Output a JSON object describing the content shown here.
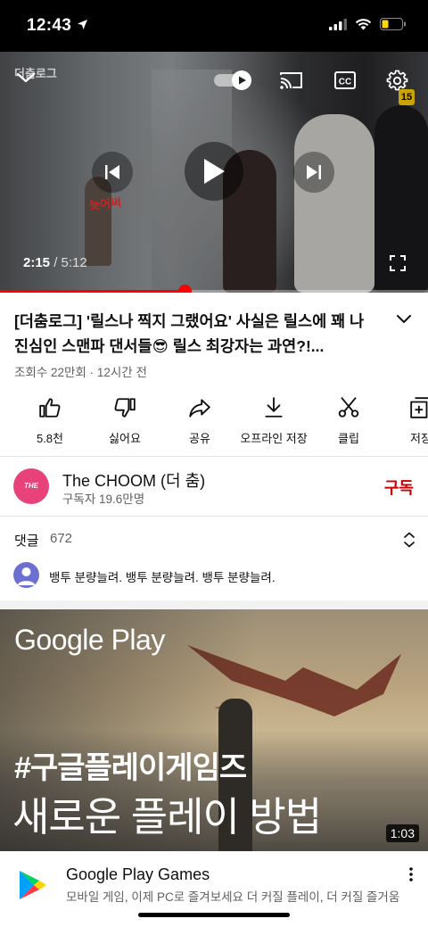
{
  "status_bar": {
    "time": "12:43"
  },
  "player": {
    "current_time": "2:15",
    "duration": "/ 5:12",
    "progress": 0.432,
    "channel_watermark": "더춤로그",
    "subtitle_overlay": "늦어써",
    "age_badge": "15"
  },
  "video": {
    "title": "[더춤로그] '릴스나 찍지 그랬어요' 사실은 릴스에 꽤 나 진심인 스맨파 댄서들😎 릴스 최강자는 과연?!...",
    "meta": "조회수 22만회 · 12시간 전"
  },
  "actions": [
    {
      "label": "5.8천",
      "icon": "thumb-up-icon"
    },
    {
      "label": "싫어요",
      "icon": "thumb-down-icon"
    },
    {
      "label": "공유",
      "icon": "share-icon"
    },
    {
      "label": "오프라인 저장",
      "icon": "download-icon"
    },
    {
      "label": "클립",
      "icon": "scissors-icon"
    },
    {
      "label": "저장",
      "icon": "save-playlist-icon"
    }
  ],
  "channel": {
    "name": "The CHOOM (더 춤)",
    "subscribers": "구독자 19.6만명",
    "avatar_text": "THE CHOOM",
    "subscribe_label": "구독"
  },
  "comments": {
    "label": "댓글",
    "count": "672",
    "top_comment": "뱅투 분량늘려. 뱅투 분량늘려. 뱅투 분량늘려."
  },
  "ad": {
    "brand_overlay": "Google Play",
    "hashtag": "#구글플레이게임즈",
    "headline": "새로운 플레이 방법",
    "duration": "1:03",
    "title": "Google Play Games",
    "description": "모바일 게임, 이제 PC로 즐겨보세요 더 커질 플레이, 더 커질 즐거움"
  },
  "colors": {
    "accent_red": "#ff0000",
    "subscribe_red": "#cc0000",
    "avatar_pink": "#e8427a"
  }
}
